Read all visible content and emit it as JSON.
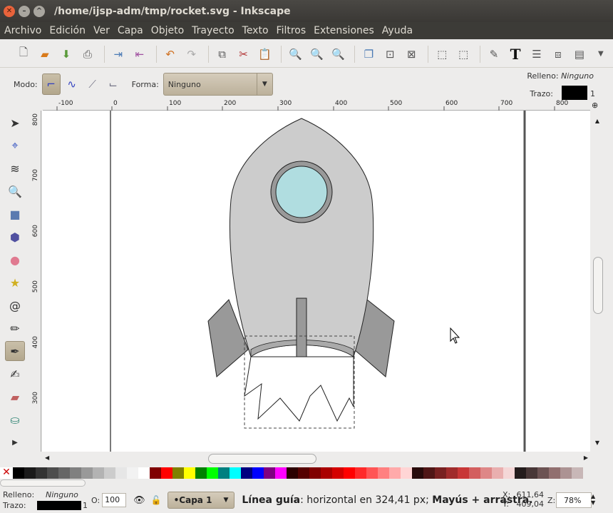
{
  "window": {
    "title": "/home/ijsp-adm/tmp/rocket.svg - Inkscape"
  },
  "menu": [
    "Archivo",
    "Edición",
    "Ver",
    "Capa",
    "Objeto",
    "Trayecto",
    "Texto",
    "Filtros",
    "Extensiones",
    "Ayuda"
  ],
  "ctrl": {
    "modo_label": "Modo:",
    "forma_label": "Forma:",
    "forma_value": "Ninguno",
    "fill_label": "Relleno:",
    "fill_value": "Ninguno",
    "stroke_label": "Trazo:",
    "stroke_width": "1"
  },
  "ruler": {
    "h_ticks": [
      "-100",
      "0",
      "100",
      "200",
      "300",
      "400",
      "500",
      "600",
      "700",
      "800"
    ],
    "v_ticks": [
      "800",
      "700",
      "600",
      "500",
      "400",
      "300"
    ]
  },
  "palette": [
    "#000000",
    "#1a1a1a",
    "#333333",
    "#4d4d4d",
    "#666666",
    "#808080",
    "#999999",
    "#b3b3b3",
    "#cccccc",
    "#e6e6e6",
    "#f2f2f2",
    "#ffffff",
    "#800000",
    "#ff0000",
    "#808000",
    "#ffff00",
    "#008000",
    "#00ff00",
    "#008080",
    "#00ffff",
    "#000080",
    "#0000ff",
    "#800080",
    "#ff00ff",
    "#2b0000",
    "#550000",
    "#800000",
    "#aa0000",
    "#d40000",
    "#ff0000",
    "#ff2a2a",
    "#ff5555",
    "#ff8080",
    "#ffaaaa",
    "#ffd5d5",
    "#280b0b",
    "#501616",
    "#782121",
    "#a02c2c",
    "#c83737",
    "#d35f5f",
    "#de8787",
    "#e9afaf",
    "#f4d7d7",
    "#241c1c",
    "#483737",
    "#6c5353",
    "#916f6f",
    "#ac9393",
    "#c8b7b7"
  ],
  "status": {
    "fill_label": "Relleno:",
    "fill_value": "Ninguno",
    "stroke_label": "Trazo:",
    "stroke_width": "1",
    "opacity_label": "O:",
    "opacity_value": "100",
    "layer": "•Capa 1",
    "message_bold": "Línea guía",
    "message_rest": ": horizontal en 324,41 px; ",
    "message_bold2": "Mayús + arrastra.",
    "x_label": "X:",
    "x_value": "611,64",
    "y_label": "Y:",
    "y_value": "409,04",
    "zoom_label": "Z:",
    "zoom_value": "78%"
  }
}
